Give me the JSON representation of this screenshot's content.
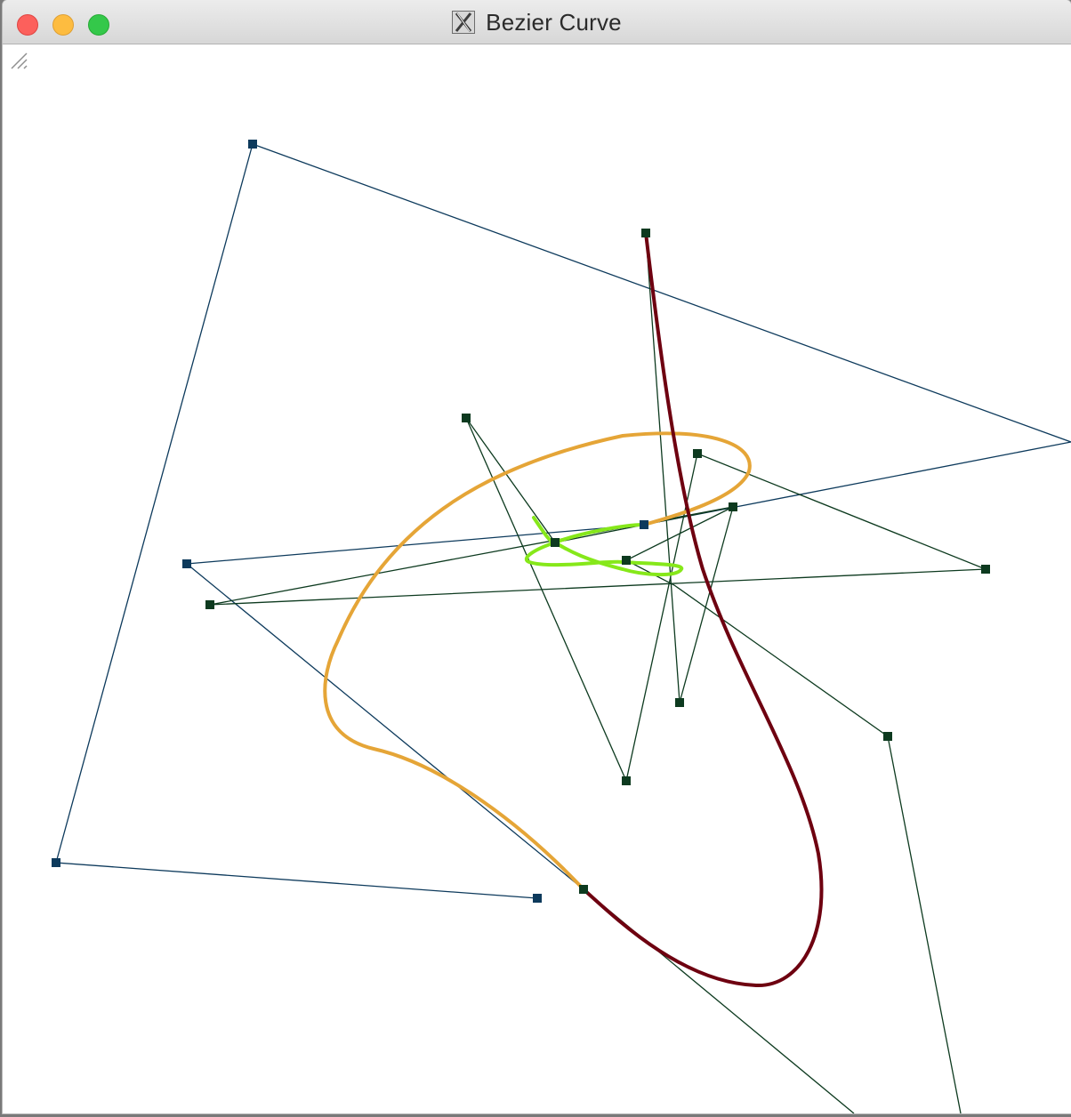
{
  "window": {
    "title": "Bezier Curve",
    "app_icon": "x11-icon",
    "buttons": [
      "close",
      "minimize",
      "zoom"
    ]
  },
  "colors": {
    "control_polygon_blue": "#0d3a5c",
    "control_polygon_green": "#0d3a1f",
    "curve_orange": "#e5a537",
    "curve_darkred": "#6e0010",
    "curve_lime": "#86e81a"
  }
}
